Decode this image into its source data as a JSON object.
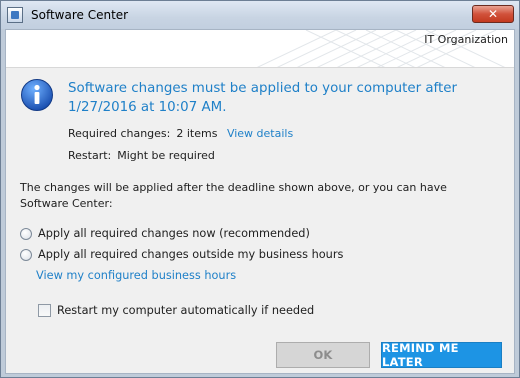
{
  "window": {
    "title": "Software Center",
    "close_glyph": "✕"
  },
  "banner": {
    "organization": "IT Organization"
  },
  "message": {
    "headline": "Software changes must be applied to your computer after 1/27/2016 at 10:07 AM.",
    "required_changes_label": "Required changes:",
    "required_changes_value": "2 items",
    "view_details_link": "View details",
    "restart_label": "Restart:",
    "restart_value": "Might be required",
    "explanation": "The changes will be applied after the deadline shown above, or you can have Software Center:"
  },
  "options": {
    "apply_now_label": "Apply all required changes now (recommended)",
    "apply_outside_label": "Apply all required changes outside my business hours",
    "view_hours_link": "View my configured business hours",
    "restart_checkbox_label": "Restart my computer automatically if needed"
  },
  "buttons": {
    "ok_label": "OK",
    "remind_label": "REMIND ME LATER"
  },
  "icons": {
    "window_icon": "software-center-icon",
    "info": "info-icon"
  },
  "colors": {
    "accent_blue": "#1f80c8",
    "primary_button": "#1d94e4",
    "close_button": "#c3391f"
  }
}
